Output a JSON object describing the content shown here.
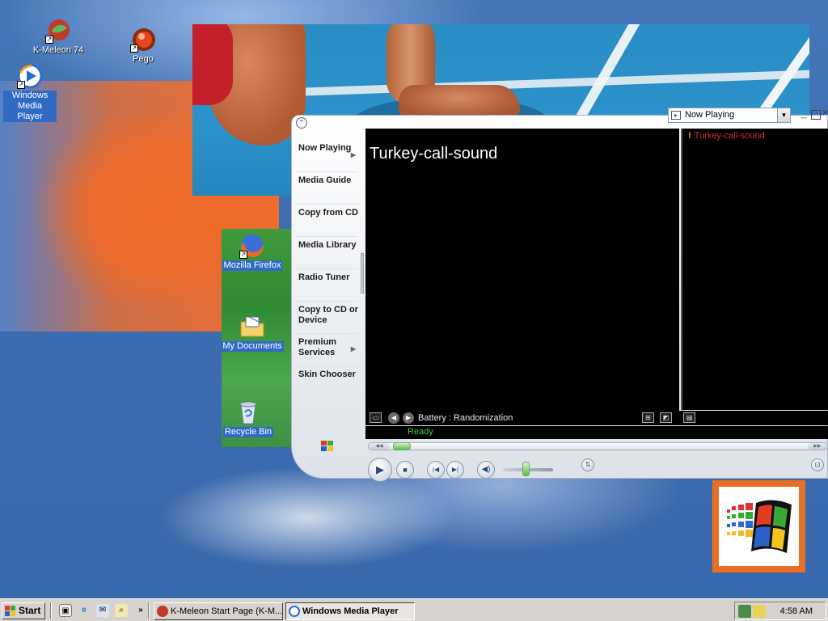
{
  "desktop": {
    "icons": [
      {
        "label": "K-Meleon 74"
      },
      {
        "label": "Pego"
      },
      {
        "label": "Windows Media Player"
      },
      {
        "label": "Mozilla Firefox"
      },
      {
        "label": "My Documents"
      },
      {
        "label": "Recycle Bin"
      }
    ]
  },
  "wmp": {
    "view_select": "Now Playing",
    "taskpane": [
      {
        "label": "Now Playing",
        "has_arrow": true
      },
      {
        "label": "Media Guide"
      },
      {
        "label": "Copy from CD"
      },
      {
        "label": "Media Library"
      },
      {
        "label": "Radio Tuner"
      },
      {
        "label": "Copy to CD or Device"
      },
      {
        "label": "Premium Services",
        "has_arrow": true
      },
      {
        "label": "Skin Chooser"
      }
    ],
    "now_playing_title": "Turkey-call-sound",
    "playlist": [
      "Turkey-call-sound"
    ],
    "visualization": "Battery : Randomization",
    "status": "Ready",
    "colors": {
      "status": "#3fd03f",
      "playlist_item": "#d8312b"
    }
  },
  "taskbar": {
    "start_label": "Start",
    "buttons": [
      {
        "label": "K-Meleon Start Page (K-M..."
      },
      {
        "label": "Windows Media Player"
      }
    ],
    "clock": "4:58 AM"
  }
}
